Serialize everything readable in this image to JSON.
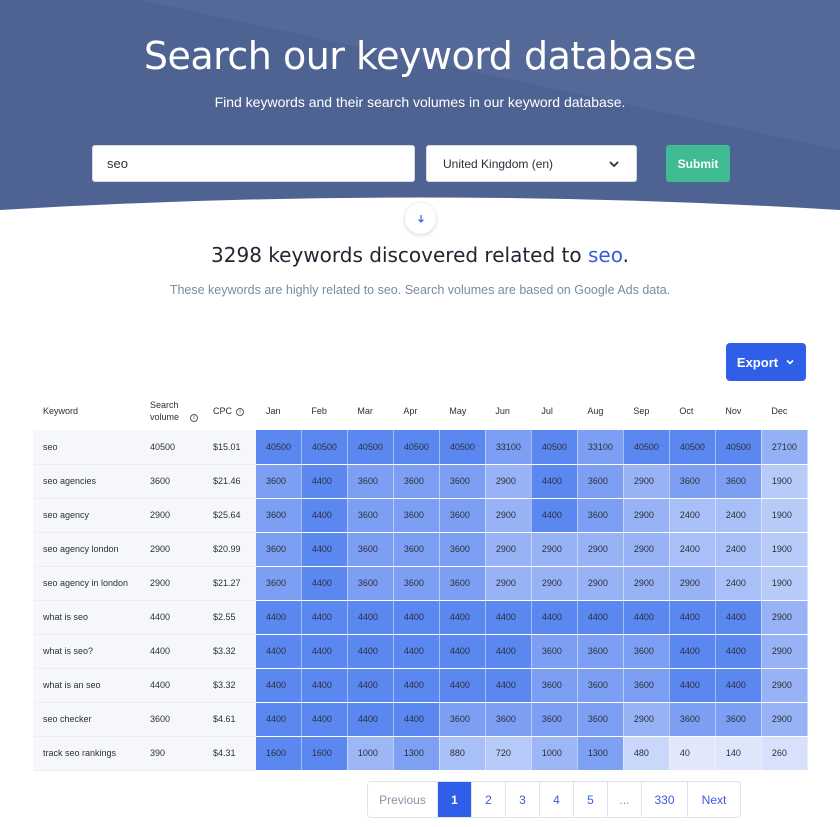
{
  "hero": {
    "title": "Search our keyword database",
    "subtitle": "Find keywords and their search volumes in our keyword database."
  },
  "search": {
    "keyword_value": "seo",
    "country_value": "United Kingdom (en)",
    "submit_label": "Submit",
    "down_icon": "arrow-down-icon"
  },
  "results": {
    "count_text": "3298 keywords discovered related to",
    "keyword": "seo",
    "period": ".",
    "note": "These keywords are highly related to seo. Search volumes are based on Google Ads data."
  },
  "export": {
    "label": "Export",
    "icon": "chevron-down-icon"
  },
  "table": {
    "headers": {
      "keyword": "Keyword",
      "volume": "Search volume",
      "cpc": "CPC",
      "months": [
        "Jan",
        "Feb",
        "Mar",
        "Apr",
        "May",
        "Jun",
        "Jul",
        "Aug",
        "Sep",
        "Oct",
        "Nov",
        "Dec"
      ]
    },
    "rows": [
      {
        "keyword": "seo",
        "volume": "40500",
        "cpc": "$15.01",
        "months": [
          "40500",
          "40500",
          "40500",
          "40500",
          "40500",
          "33100",
          "40500",
          "33100",
          "40500",
          "40500",
          "40500",
          "27100"
        ]
      },
      {
        "keyword": "seo agencies",
        "volume": "3600",
        "cpc": "$21.46",
        "months": [
          "3600",
          "4400",
          "3600",
          "3600",
          "3600",
          "2900",
          "4400",
          "3600",
          "2900",
          "3600",
          "3600",
          "1900"
        ]
      },
      {
        "keyword": "seo agency",
        "volume": "2900",
        "cpc": "$25.64",
        "months": [
          "3600",
          "4400",
          "3600",
          "3600",
          "3600",
          "2900",
          "4400",
          "3600",
          "2900",
          "2400",
          "2400",
          "1900"
        ]
      },
      {
        "keyword": "seo agency london",
        "volume": "2900",
        "cpc": "$20.99",
        "months": [
          "3600",
          "4400",
          "3600",
          "3600",
          "3600",
          "2900",
          "2900",
          "2900",
          "2900",
          "2400",
          "2400",
          "1900"
        ]
      },
      {
        "keyword": "seo agency in london",
        "volume": "2900",
        "cpc": "$21.27",
        "months": [
          "3600",
          "4400",
          "3600",
          "3600",
          "3600",
          "2900",
          "2900",
          "2900",
          "2900",
          "2900",
          "2400",
          "1900"
        ]
      },
      {
        "keyword": "what is seo",
        "volume": "4400",
        "cpc": "$2.55",
        "months": [
          "4400",
          "4400",
          "4400",
          "4400",
          "4400",
          "4400",
          "4400",
          "4400",
          "4400",
          "4400",
          "4400",
          "2900"
        ]
      },
      {
        "keyword": "what is seo?",
        "volume": "4400",
        "cpc": "$3.32",
        "months": [
          "4400",
          "4400",
          "4400",
          "4400",
          "4400",
          "4400",
          "3600",
          "3600",
          "3600",
          "4400",
          "4400",
          "2900"
        ]
      },
      {
        "keyword": "what is an seo",
        "volume": "4400",
        "cpc": "$3.32",
        "months": [
          "4400",
          "4400",
          "4400",
          "4400",
          "4400",
          "4400",
          "3600",
          "3600",
          "3600",
          "4400",
          "4400",
          "2900"
        ]
      },
      {
        "keyword": "seo checker",
        "volume": "3600",
        "cpc": "$4.61",
        "months": [
          "4400",
          "4400",
          "4400",
          "4400",
          "3600",
          "3600",
          "3600",
          "3600",
          "2900",
          "3600",
          "3600",
          "2900"
        ]
      },
      {
        "keyword": "track seo rankings",
        "volume": "390",
        "cpc": "$4.31",
        "months": [
          "1600",
          "1600",
          "1000",
          "1300",
          "880",
          "720",
          "1000",
          "1300",
          "480",
          "40",
          "140",
          "260"
        ]
      }
    ]
  },
  "pagination": {
    "items": [
      {
        "label": "Previous",
        "state": "disabled"
      },
      {
        "label": "1",
        "state": "active"
      },
      {
        "label": "2",
        "state": "normal"
      },
      {
        "label": "3",
        "state": "normal"
      },
      {
        "label": "4",
        "state": "normal"
      },
      {
        "label": "5",
        "state": "normal"
      },
      {
        "label": "...",
        "state": "disabled"
      },
      {
        "label": "330",
        "state": "normal"
      },
      {
        "label": "Next",
        "state": "normal"
      }
    ]
  },
  "colors": {
    "hero_bg": "#4e6392",
    "hero_bg_light": "#5a6f9c",
    "submit": "#3ebb92",
    "primary": "#2f5ee8",
    "heat_light": "#e2e9fc",
    "heat_dark": "#5b87f0"
  }
}
